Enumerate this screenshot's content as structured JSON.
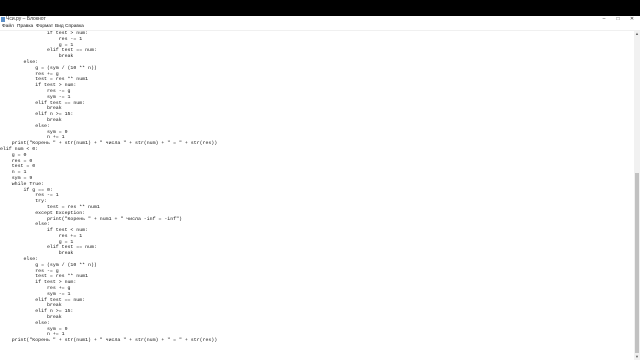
{
  "window": {
    "title": "Чси.py – Блокнот",
    "controls": [
      "–",
      "□",
      "✕"
    ]
  },
  "menu": [
    "Файл",
    "Правка",
    "Формат",
    "Вид",
    "Справка"
  ],
  "code_lines": [
    "                if test > num:",
    "                    res -= 1",
    "                    g = 1",
    "                elif test == num:",
    "                    break",
    "        else:",
    "            g = (sym / (10 ** n))",
    "            res += g",
    "            test = res ** num1",
    "            if test > num:",
    "                res -= g",
    "                sym -= 1",
    "            elif test == num:",
    "                break",
    "            elif n >= 15:",
    "                break",
    "            else:",
    "                sym = 9",
    "                n += 1",
    "    print(\"Корень \" + str(num1) + \" числа \" + str(num) + \" = \" + str(res))",
    "elif num < 0:",
    "    g = 0",
    "    res = 0",
    "    test = 0",
    "    n = 1",
    "    sym = 9",
    "    while True:",
    "        if g == 0:",
    "            res -= 1",
    "            try:",
    "                test = res ** num1",
    "            except Exception:",
    "                print(\"Корень \" + num1 + \" числа -inf = -inf\")",
    "            else:",
    "                if test < num:",
    "                    res += 1",
    "                    g = 1",
    "                elif test == num:",
    "                    break",
    "        else:",
    "            g = (sym / (10 ** n))",
    "            res -= g",
    "            test = res ** num1",
    "            if test > num:",
    "                res += g",
    "                sym -= 1",
    "            elif test == num:",
    "                break",
    "            elif n >= 15:",
    "                break",
    "            else:",
    "                sym = 9",
    "                n += 1",
    "    print(\"Корень \" + str(num1) + \" числа \" + str(num) + \" = \" + str(res))"
  ],
  "colors": {
    "window_bg": "#ffffff",
    "text": "#111111",
    "outer_bg": "#000000",
    "scroll_thumb": "#c1c1c1"
  },
  "icons": [
    "notepad-icon",
    "minimize-icon",
    "maximize-icon",
    "close-icon",
    "scroll-up-icon",
    "scroll-down-icon"
  ]
}
